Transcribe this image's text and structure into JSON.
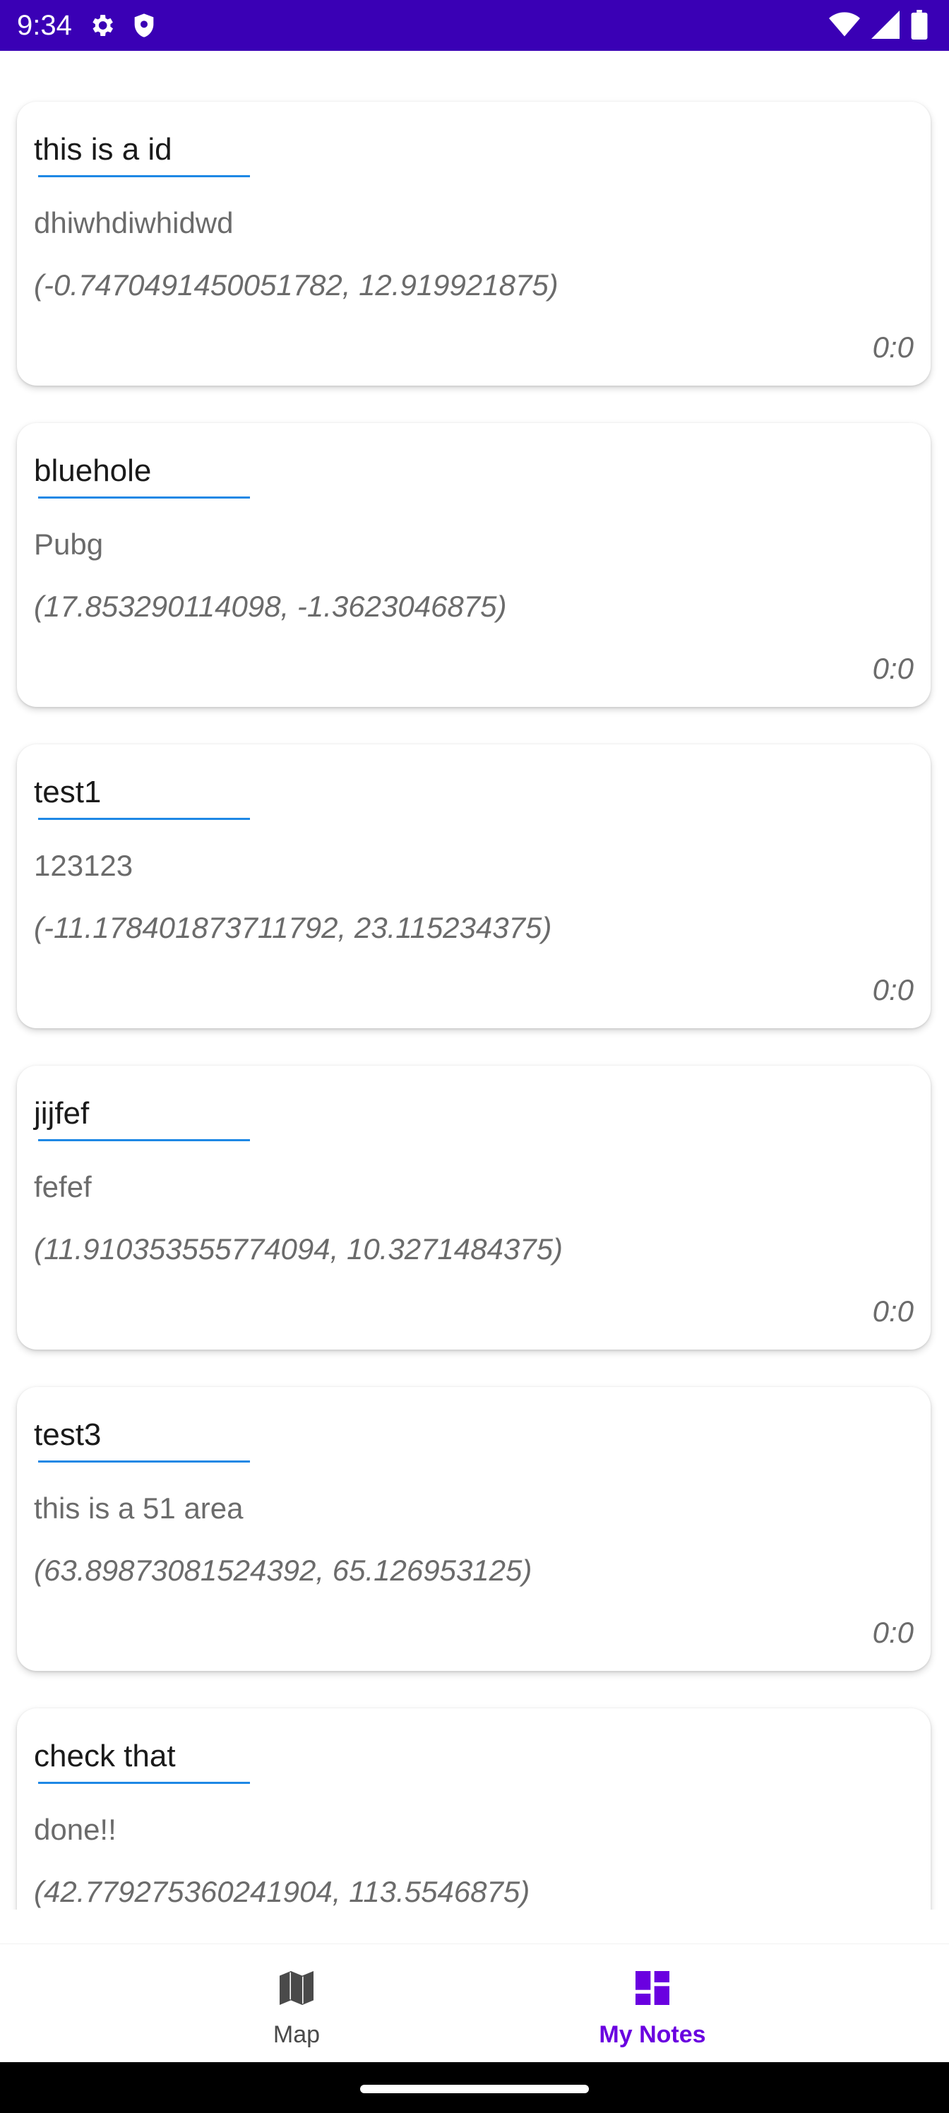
{
  "status_bar": {
    "time": "9:34",
    "background": "#3a00b5"
  },
  "notes": [
    {
      "title": "this is a id",
      "description": "dhiwhdiwhidwd",
      "coords": "(-0.7470491450051782, 12.919921875)",
      "time": "0:0"
    },
    {
      "title": "bluehole",
      "description": "Pubg",
      "coords": "(17.853290114098, -1.3623046875)",
      "time": "0:0"
    },
    {
      "title": "test1",
      "description": "123123",
      "coords": "(-11.178401873711792, 23.115234375)",
      "time": "0:0"
    },
    {
      "title": "jijfef",
      "description": "fefef",
      "coords": "(11.910353555774094, 10.3271484375)",
      "time": "0:0"
    },
    {
      "title": "test3",
      "description": "this is a 51 area",
      "coords": "(63.89873081524392, 65.126953125)",
      "time": "0:0"
    },
    {
      "title": "check that",
      "description": "done!!",
      "coords": "(42.779275360241904, 113.5546875)",
      "time": ""
    }
  ],
  "bottom_nav": {
    "items": [
      {
        "label": "Map",
        "icon": "map-icon",
        "active": false
      },
      {
        "label": "My Notes",
        "icon": "dashboard-icon",
        "active": true
      }
    ],
    "active_color": "#6a00e0",
    "inactive_color": "#4a4a4a"
  }
}
